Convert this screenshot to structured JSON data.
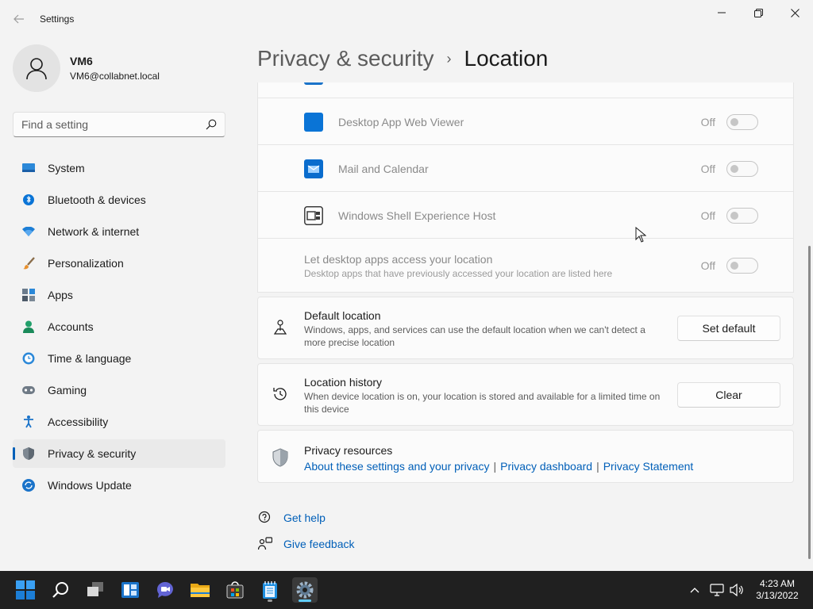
{
  "window": {
    "title": "Settings",
    "controls": {
      "minimize": "minimize-icon",
      "maximize": "restore-icon",
      "close": "close-icon"
    }
  },
  "profile": {
    "name": "VM6",
    "email": "VM6@collabnet.local"
  },
  "search": {
    "placeholder": "Find a setting",
    "value": ""
  },
  "sidebar": {
    "items": [
      {
        "label": "System",
        "icon": "system-icon"
      },
      {
        "label": "Bluetooth & devices",
        "icon": "bluetooth-icon"
      },
      {
        "label": "Network & internet",
        "icon": "wifi-icon"
      },
      {
        "label": "Personalization",
        "icon": "brush-icon"
      },
      {
        "label": "Apps",
        "icon": "apps-icon"
      },
      {
        "label": "Accounts",
        "icon": "accounts-icon"
      },
      {
        "label": "Time & language",
        "icon": "clock-globe-icon"
      },
      {
        "label": "Gaming",
        "icon": "gamepad-icon"
      },
      {
        "label": "Accessibility",
        "icon": "accessibility-icon"
      },
      {
        "label": "Privacy & security",
        "icon": "shield-icon",
        "active": true
      },
      {
        "label": "Windows Update",
        "icon": "update-icon"
      }
    ]
  },
  "header": {
    "parent": "Privacy & security",
    "separator": "›",
    "current": "Location"
  },
  "app_access": [
    {
      "name": "Desktop App Web Viewer",
      "state": "Off",
      "icon": "blue-square-app-icon"
    },
    {
      "name": "Mail and Calendar",
      "state": "Off",
      "icon": "mail-app-icon"
    },
    {
      "name": "Windows Shell Experience Host",
      "state": "Off",
      "icon": "shell-host-icon"
    }
  ],
  "desktop_apps": {
    "title": "Let desktop apps access your location",
    "desc": "Desktop apps that have previously accessed your location are listed here",
    "state": "Off"
  },
  "default_location": {
    "title": "Default location",
    "desc": "Windows, apps, and services can use the default location when we can't detect a more precise location",
    "button": "Set default"
  },
  "location_history": {
    "title": "Location history",
    "desc": "When device location is on, your location is stored and available for a limited time on this device",
    "button": "Clear"
  },
  "privacy_resources": {
    "title": "Privacy resources",
    "links": [
      "About these settings and your privacy",
      "Privacy dashboard",
      "Privacy Statement"
    ],
    "separator": "|"
  },
  "help": {
    "get_help": "Get help",
    "give_feedback": "Give feedback"
  },
  "taskbar": {
    "apps": [
      "start-icon",
      "search-icon",
      "task-view-icon",
      "widgets-icon",
      "teams-chat-icon",
      "file-explorer-icon",
      "store-icon",
      "notepad-icon",
      "settings-icon"
    ],
    "tray": [
      "chevron-up-icon",
      "network-icon",
      "volume-icon"
    ],
    "time": "4:23 AM",
    "date": "3/13/2022"
  },
  "colors": {
    "accent": "#005fb8",
    "taskbar": "#202020",
    "background": "#f3f3f3",
    "card": "#fbfbfb"
  }
}
